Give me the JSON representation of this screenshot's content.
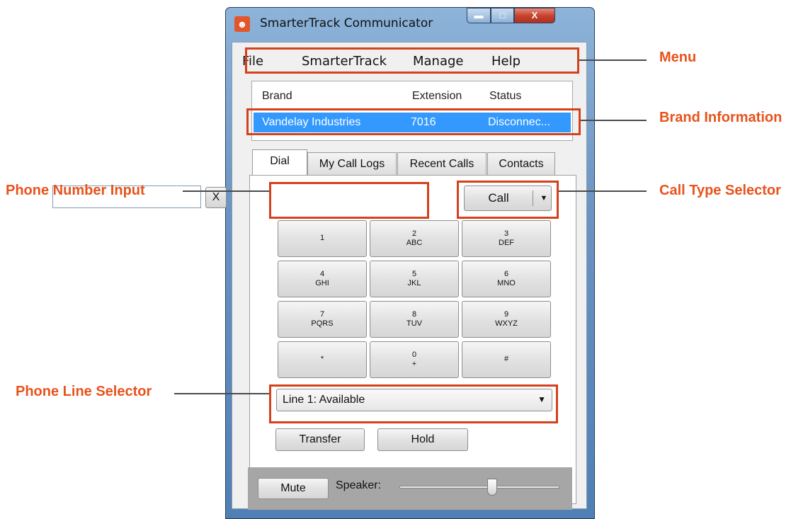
{
  "window": {
    "title": "SmarterTrack Communicator",
    "icon": "person-icon",
    "controls": {
      "minimize": "minimize-icon",
      "maximize": "maximize-icon",
      "close": "close-icon",
      "close_glyph": "X"
    }
  },
  "menu": {
    "items": [
      "File",
      "SmarterTrack",
      "Manage",
      "Help"
    ]
  },
  "brand_list": {
    "columns": [
      "Brand",
      "Extension",
      "Status"
    ],
    "rows": [
      {
        "brand": "Vandelay Industries",
        "extension": "7016",
        "status": "Disconnec..."
      }
    ],
    "selected_row_color": "#3399ff"
  },
  "tabs": [
    {
      "label": "Dial",
      "active": true
    },
    {
      "label": "My Call Logs",
      "active": false
    },
    {
      "label": "Recent Calls",
      "active": false
    },
    {
      "label": "Contacts",
      "active": false
    }
  ],
  "dial": {
    "phone_number_value": "",
    "clear_label": "X",
    "call_label": "Call",
    "keypad": [
      {
        "digit": "1",
        "letters": ""
      },
      {
        "digit": "2",
        "letters": "ABC"
      },
      {
        "digit": "3",
        "letters": "DEF"
      },
      {
        "digit": "4",
        "letters": "GHI"
      },
      {
        "digit": "5",
        "letters": "JKL"
      },
      {
        "digit": "6",
        "letters": "MNO"
      },
      {
        "digit": "7",
        "letters": "PQRS"
      },
      {
        "digit": "8",
        "letters": "TUV"
      },
      {
        "digit": "9",
        "letters": "WXYZ"
      },
      {
        "digit": "*",
        "letters": ""
      },
      {
        "digit": "0",
        "letters": "+"
      },
      {
        "digit": "#",
        "letters": ""
      }
    ],
    "line_selected": "Line 1: Available",
    "transfer_label": "Transfer",
    "hold_label": "Hold"
  },
  "audio": {
    "mute_label": "Mute",
    "speaker_label": "Speaker:",
    "speaker_level": 0.58
  },
  "callouts": {
    "menu": "Menu",
    "brand_information": "Brand Information",
    "phone_number_input": "Phone Number Input",
    "call_type_selector": "Call Type Selector",
    "phone_line_selector": "Phone Line Selector"
  },
  "colors": {
    "callout_text": "#e8531d",
    "highlight_border": "#d5411c"
  }
}
